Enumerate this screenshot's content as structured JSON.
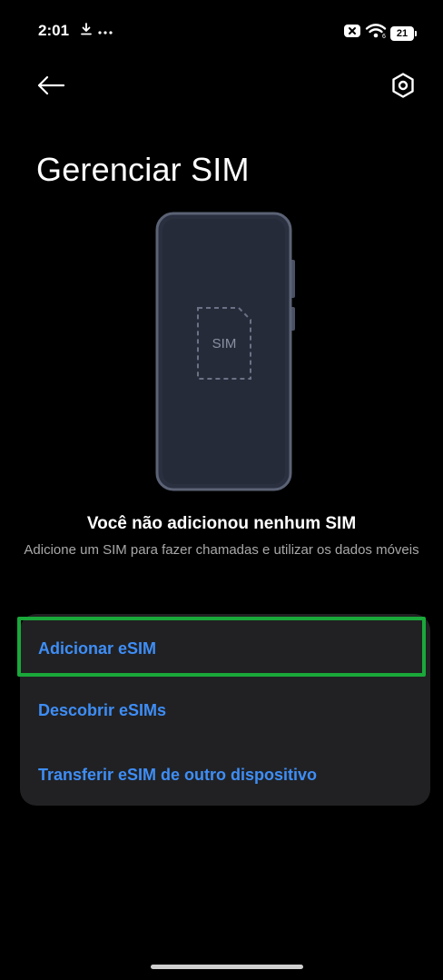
{
  "status_bar": {
    "time": "2:01",
    "left_icons": [
      "download-icon",
      "more-dots-icon"
    ],
    "right_icons": [
      "no-sim-icon",
      "wifi-icon",
      "battery-icon"
    ],
    "battery_level": "21"
  },
  "header": {
    "back_icon": "arrow-left-icon",
    "settings_icon": "settings-hex-icon",
    "title": "Gerenciar SIM"
  },
  "illustration": {
    "sim_label": "SIM"
  },
  "empty_state": {
    "title": "Você não adicionou nenhum SIM",
    "subtitle": "Adicione um SIM para fazer chamadas e utilizar os dados móveis"
  },
  "options": [
    {
      "label": "Adicionar eSIM"
    },
    {
      "label": "Descobrir eSIMs"
    },
    {
      "label": "Transferir eSIM de outro dispositivo"
    }
  ],
  "colors": {
    "background": "#000000",
    "card": "#212123",
    "accent": "#3e8ef7",
    "highlight": "#1aa83a",
    "secondary_text": "#a8a8a8"
  }
}
